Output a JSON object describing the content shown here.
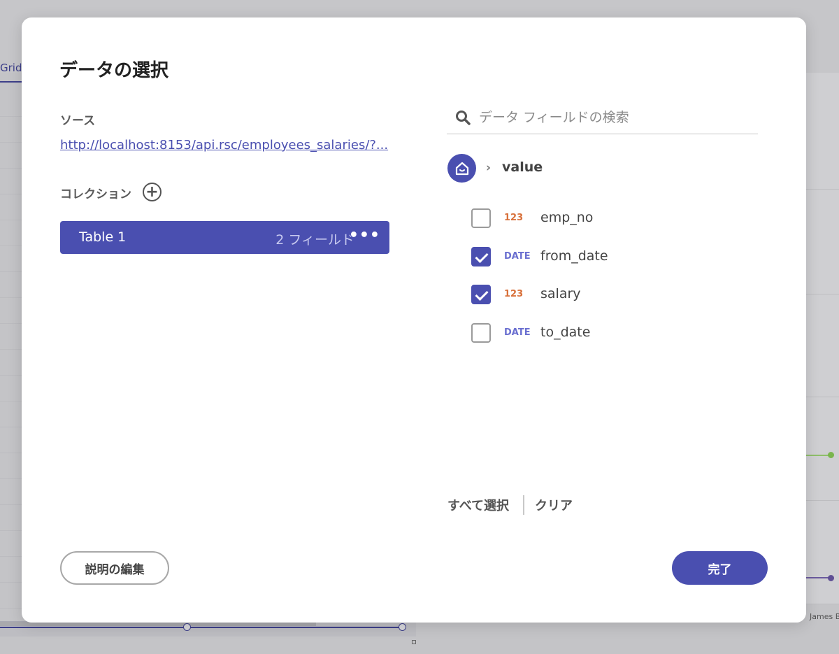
{
  "background": {
    "grid_tab_label": "Grid",
    "axis_label": "James B"
  },
  "dialog": {
    "title": "データの選択",
    "source_label": "ソース",
    "source_url": "http://localhost:8153/api.rsc/employees_salaries/?...",
    "collection_label": "コレクション",
    "collections": [
      {
        "name": "Table 1",
        "field_count": "2 フィールド",
        "more": "•••"
      }
    ],
    "search_placeholder": "データ フィールドの検索",
    "breadcrumb": {
      "current": "value"
    },
    "fields": [
      {
        "type": "123",
        "name": "emp_no",
        "checked": false
      },
      {
        "type": "DATE",
        "name": "from_date",
        "checked": true
      },
      {
        "type": "123",
        "name": "salary",
        "checked": true
      },
      {
        "type": "DATE",
        "name": "to_date",
        "checked": false
      }
    ],
    "select_all_label": "すべて選択",
    "clear_label": "クリア",
    "edit_description_label": "説明の編集",
    "done_label": "完了"
  },
  "colors": {
    "accent": "#4a4fb0",
    "number_type": "#d8703a",
    "date_type": "#6a6fd0"
  }
}
